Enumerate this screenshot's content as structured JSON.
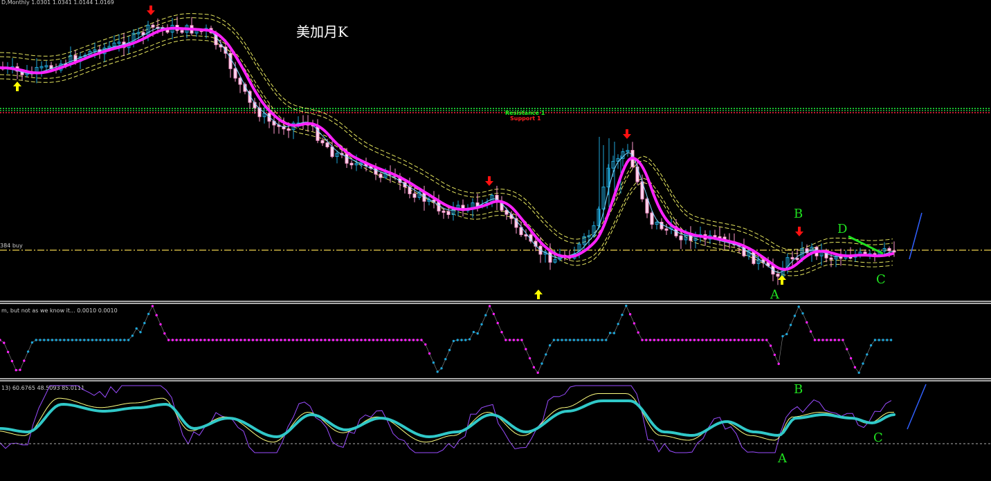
{
  "header": {
    "price_pane": "D,Monthly  1.0301 1.0341 1.0144 1.0169",
    "indicator_pane": "m, but not as we know it...  0.0010 0.0010",
    "oscillator_pane": "13) 60.6765 48.5093 85.0111"
  },
  "chart_title": "美加月K",
  "levels": {
    "buy_label": "384 buy",
    "resistance_label": "Resistance 1",
    "support_label": "Support 1"
  },
  "pattern_labels": {
    "A": "A",
    "B": "B",
    "C": "C",
    "D": "D"
  },
  "colors": {
    "background": "#000000",
    "bull_candle": "#1fa6d8",
    "bear_candle": "#ff9ad0",
    "ma_fast": "#ff22ff",
    "ma_thin": "#7ad7ff",
    "channel": "#e8e860",
    "resistance": "#20ff40",
    "support": "#ff2040",
    "buy_line": "#c8b040",
    "label_green": "#20e020",
    "arrow_up": "#ffff00",
    "arrow_down": "#ff1010",
    "osc_main": "#30c8c8",
    "osc_signal": "#ffff80",
    "osc_raw": "#9a4cff"
  },
  "chart_data": [
    {
      "type": "line",
      "name": "price",
      "title": "",
      "x": [
        0,
        1,
        2,
        3,
        4,
        5,
        6,
        7,
        8,
        9,
        10,
        11,
        12,
        13,
        14,
        15,
        16,
        17,
        18,
        19,
        20,
        21,
        22,
        23,
        24,
        25,
        26,
        27,
        28,
        29,
        30,
        31,
        32,
        33,
        34,
        35,
        36,
        37,
        38,
        39,
        40,
        41,
        42,
        43,
        44,
        45,
        46,
        47,
        48,
        49,
        50,
        51,
        52,
        53,
        54,
        55,
        56,
        57,
        58,
        59,
        60,
        61,
        62,
        63,
        64,
        65,
        66,
        67,
        68,
        69,
        70,
        71,
        72,
        73,
        74,
        75,
        76,
        77,
        78,
        79,
        80,
        81,
        82,
        83,
        84,
        85,
        86,
        87,
        88,
        89,
        90,
        91,
        92,
        93,
        94,
        95,
        96,
        97,
        98,
        99,
        100,
        101,
        102,
        103,
        104,
        105,
        106,
        107,
        108,
        109,
        110,
        111,
        112,
        113,
        114,
        115,
        116,
        117,
        118,
        119,
        120,
        121,
        122,
        123,
        124,
        125,
        126,
        127,
        128,
        129,
        130,
        131,
        132,
        133,
        134,
        135,
        136,
        137,
        138,
        139,
        140,
        141,
        142,
        143,
        144,
        145,
        146,
        147,
        148,
        149,
        150,
        151,
        152,
        153,
        154,
        155,
        156,
        157,
        158,
        159,
        160,
        161,
        162,
        163,
        164,
        165,
        166,
        167,
        168,
        169,
        170,
        171,
        172,
        173,
        174,
        175,
        176,
        177,
        178,
        179,
        180,
        181,
        182,
        183,
        184,
        185,
        186,
        187,
        188,
        189,
        190,
        191,
        192,
        193,
        194,
        195,
        196,
        197,
        198,
        199,
        200,
        201,
        202,
        203,
        204,
        205,
        206,
        207,
        208,
        209,
        210,
        211,
        212,
        213,
        214,
        215,
        216,
        217,
        218,
        219
      ],
      "close_path": [
        98,
        100,
        104,
        112,
        110,
        104,
        100,
        95,
        92,
        93,
        86,
        88,
        84,
        80,
        75,
        70,
        66,
        62,
        58,
        55,
        52,
        60,
        66,
        64,
        62,
        60,
        56,
        52,
        48,
        44,
        40,
        38,
        36,
        34,
        32,
        30,
        35,
        33,
        38,
        42,
        40,
        44,
        46,
        42,
        44,
        46,
        50,
        48,
        52,
        62,
        72,
        82,
        95,
        110,
        130,
        150,
        160,
        155,
        150,
        170,
        185,
        190,
        175,
        170,
        180,
        190,
        185,
        180,
        170,
        165,
        175,
        195,
        205,
        210,
        220,
        230,
        240,
        235,
        225,
        245,
        250,
        240,
        230,
        235,
        240,
        245,
        250,
        255,
        248,
        260,
        265,
        270,
        272,
        285,
        290,
        280,
        285,
        300,
        310,
        305,
        300,
        295,
        290,
        285,
        280,
        300,
        315,
        325,
        330,
        345,
        355,
        345,
        335,
        340,
        350,
        360,
        380,
        398,
        375,
        370,
        365,
        360,
        365,
        355,
        350,
        340,
        330,
        320,
        310,
        290,
        260,
        230,
        215,
        225,
        240,
        270,
        285,
        290,
        320,
        325,
        330,
        335,
        340,
        338,
        330,
        335,
        345,
        340,
        335,
        350,
        355,
        345,
        350,
        340,
        345,
        355,
        350,
        345,
        360,
        365,
        370,
        365,
        375,
        390,
        395,
        400,
        385,
        380,
        355,
        345,
        360,
        365,
        370,
        368,
        372,
        370,
        368,
        360,
        355,
        358,
        362,
        368,
        372,
        375,
        378,
        375,
        372,
        370,
        365,
        368,
        370
      ],
      "ma_fast": [
        95,
        96,
        97,
        99,
        100,
        99,
        97,
        95,
        93,
        91,
        89,
        87,
        85,
        82,
        79,
        76,
        73,
        70,
        67,
        64,
        61,
        59,
        57,
        56,
        55,
        54,
        53,
        51,
        49,
        46,
        44,
        42,
        41,
        40,
        40,
        41,
        42,
        44,
        46,
        50,
        55,
        62,
        72,
        85,
        100,
        115,
        130,
        142,
        152,
        160,
        166,
        170,
        174,
        178,
        182,
        185,
        188,
        190,
        192,
        194,
        196,
        198,
        200,
        202,
        204,
        206,
        207,
        208,
        210,
        213,
        216,
        222,
        228,
        234,
        240,
        244,
        246,
        248,
        250,
        252,
        255,
        258,
        262,
        266,
        272,
        280,
        290,
        300,
        310,
        320,
        330,
        340,
        348,
        355,
        360,
        365,
        368,
        370,
        368,
        362,
        350,
        330,
        310,
        290,
        270,
        262,
        265,
        272,
        282,
        294,
        305,
        316,
        325,
        332,
        338,
        342,
        345,
        348,
        350,
        352,
        354,
        356,
        358,
        360,
        362,
        364,
        366,
        368,
        372,
        378,
        384,
        380,
        376,
        374,
        373,
        372,
        372,
        372,
        372,
        372,
        372,
        371,
        371,
        371,
        370,
        370
      ]
    }
  ]
}
